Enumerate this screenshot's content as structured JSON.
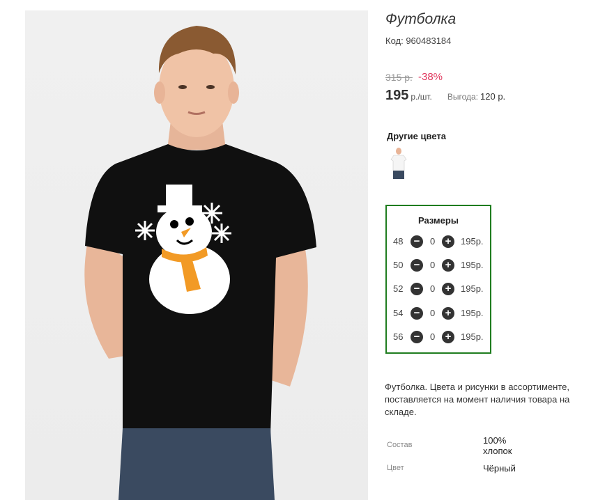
{
  "product": {
    "title": "Футболка",
    "code": "Код: 960483184",
    "old_price": "315 р.",
    "discount": "-38%",
    "price": "195",
    "price_unit": "р./шт.",
    "profit_label": "Выгода:",
    "profit_value": "120 р."
  },
  "colors": {
    "heading": "Другие цвета"
  },
  "sizes": {
    "heading": "Размеры",
    "minus_icon": "minus-circle-icon",
    "plus_icon": "plus-circle-icon",
    "rows": [
      {
        "size": "48",
        "qty": "0",
        "price": "195р."
      },
      {
        "size": "50",
        "qty": "0",
        "price": "195р."
      },
      {
        "size": "52",
        "qty": "0",
        "price": "195р."
      },
      {
        "size": "54",
        "qty": "0",
        "price": "195р."
      },
      {
        "size": "56",
        "qty": "0",
        "price": "195р."
      }
    ]
  },
  "description": "Футболка. Цвета и рисунки в ассортименте, поставляется на момент наличия товара на складе.",
  "properties": [
    {
      "label": "Состав",
      "value": "100% хлопок"
    },
    {
      "label": "Цвет",
      "value": "Чёрный"
    }
  ],
  "theme": {
    "discount_color": "#e0365c",
    "sizes_border": "#1f7d1f",
    "cart_button": "#9ed05a"
  }
}
